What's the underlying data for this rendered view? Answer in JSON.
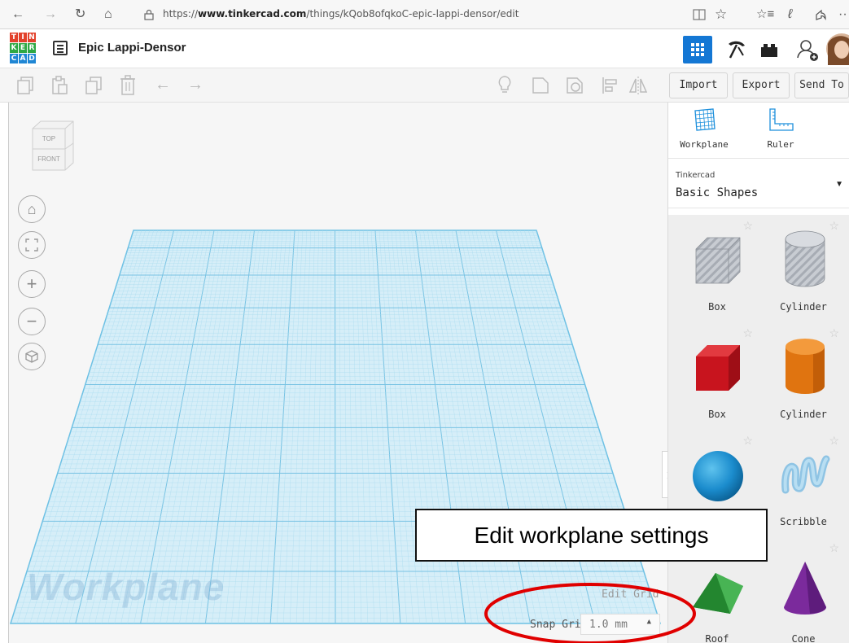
{
  "browser": {
    "url_prefix": "https://",
    "url_host": "www.tinkercad.com",
    "url_path": "/things/kQob8ofqkoC-epic-lappi-densor/edit"
  },
  "app": {
    "logo_letters": [
      "T",
      "I",
      "N",
      "K",
      "E",
      "R",
      "C",
      "A",
      "D"
    ],
    "design_title": "Epic Lappi-Densor",
    "accent_color": "#1477d4"
  },
  "toolbar": {
    "import_label": "Import",
    "export_label": "Export",
    "send_to_label": "Send To"
  },
  "viewcube": {
    "top_label": "TOP",
    "front_label": "FRONT"
  },
  "canvas": {
    "workplane_label": "Workplane",
    "edit_grid_label": "Edit Grid",
    "snap_grid_label": "Snap Grid",
    "snap_grid_value": "1.0 mm"
  },
  "panel": {
    "workplane_tool_label": "Workplane",
    "ruler_tool_label": "Ruler",
    "library_source": "Tinkercad",
    "library_name": "Basic Shapes",
    "shapes": [
      {
        "label": "Box",
        "icon": "box-hole-icon"
      },
      {
        "label": "Cylinder",
        "icon": "cylinder-hole-icon"
      },
      {
        "label": "Box",
        "icon": "box-icon"
      },
      {
        "label": "Cylinder",
        "icon": "cylinder-icon"
      },
      {
        "label": "",
        "icon": "sphere-icon"
      },
      {
        "label": "Scribble",
        "icon": "scribble-icon"
      },
      {
        "label": "Roof",
        "icon": "roof-icon"
      },
      {
        "label": "Cone",
        "icon": "cone-icon"
      }
    ]
  },
  "annotation": {
    "callout_text": "Edit workplane settings",
    "highlight_color": "#e00000"
  }
}
